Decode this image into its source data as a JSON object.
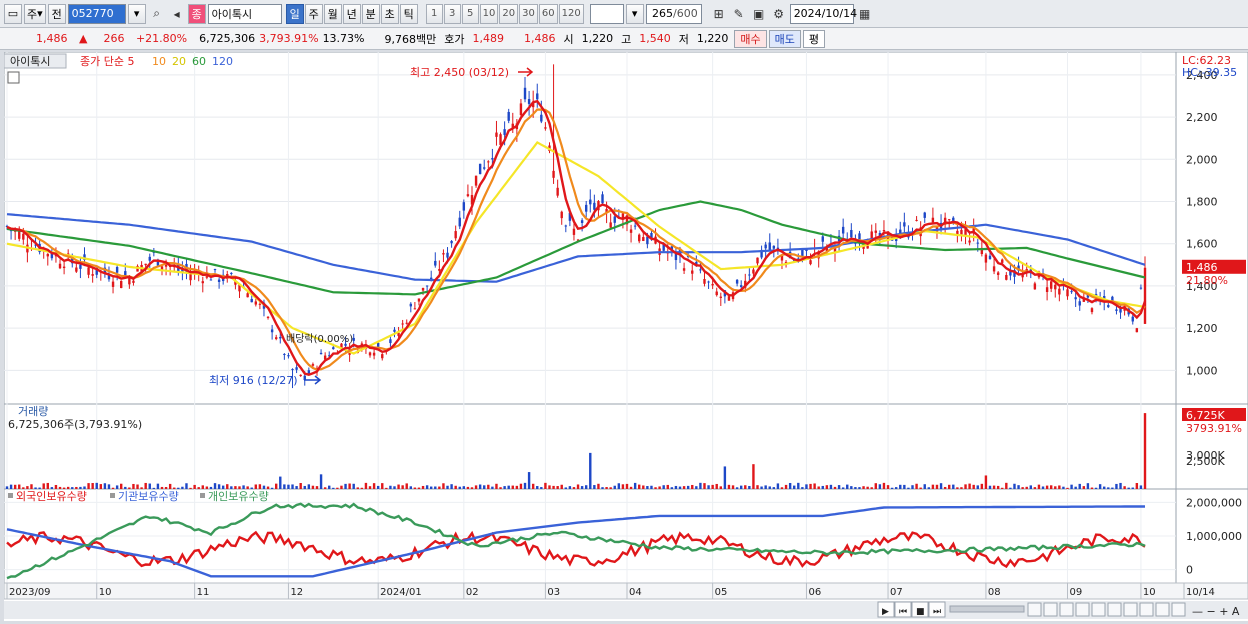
{
  "toolbar": {
    "period_label": "주",
    "prev_label": "전",
    "code": "052770",
    "stock_name": "아이톡시",
    "stock_tag": "종",
    "tabs": [
      "일",
      "주",
      "월",
      "년",
      "분",
      "초",
      "틱"
    ],
    "active_tab": "일",
    "minutes": [
      "1",
      "3",
      "5",
      "10",
      "20",
      "30",
      "60",
      "120"
    ],
    "count": "265",
    "count_total": "/600",
    "date": "2024/10/14"
  },
  "info": {
    "price": "1,486",
    "change_arrow": "▲",
    "change": "266",
    "change_pct": "+21.80%",
    "volume": "6,725,306",
    "volume_pct": "3,793.91%",
    "turnover_pct": "13.73%",
    "trade_value": "9,768백만",
    "quote_label": "호가",
    "ask": "1,489",
    "bid": "1,486",
    "open_label": "시",
    "open": "1,220",
    "high_label": "고",
    "high": "1,540",
    "low_label": "저",
    "low": "1,220",
    "buy_label": "매수",
    "sell_label": "매도",
    "eval_label": "평"
  },
  "colors": {
    "up": "#e0171a",
    "down": "#1d47c7",
    "ma5": "#e0171a",
    "ma10": "#f08a1c",
    "ma20": "#f5e628",
    "ma60": "#2a9a3a",
    "ma120": "#3a62d8",
    "foreign": "#e0171a",
    "institution": "#3a62d8",
    "individual": "#3a9a5a"
  },
  "chart_data": [
    {
      "type": "candlestick",
      "title": "아이톡시",
      "legend": {
        "prefix": "종가 단순",
        "periods": [
          "5",
          "10",
          "20",
          "60",
          "120"
        ]
      },
      "lc": "LC:62.23",
      "hc": "HC:-39.35",
      "current_price_label": "1,486",
      "current_change_label": "21.80%",
      "ylim": [
        850,
        2480
      ],
      "yticks": [
        "1,000",
        "1,200",
        "1,400",
        "1,600",
        "1,800",
        "2,000",
        "2,200",
        "2,400"
      ],
      "max_annotation": "최고 2,450 (03/12)",
      "min_annotation": "최저 916 (12/27)",
      "dividend_annotation": "배당락(0.00%)",
      "close_anchors": [
        [
          0,
          1680
        ],
        [
          12,
          1540
        ],
        [
          22,
          1470
        ],
        [
          30,
          1440
        ],
        [
          36,
          1540
        ],
        [
          42,
          1470
        ],
        [
          50,
          1450
        ],
        [
          57,
          1420
        ],
        [
          62,
          1300
        ],
        [
          66,
          1170
        ],
        [
          70,
          1000
        ],
        [
          73,
          960
        ],
        [
          77,
          1060
        ],
        [
          82,
          1120
        ],
        [
          87,
          1120
        ],
        [
          92,
          1100
        ],
        [
          96,
          1180
        ],
        [
          100,
          1320
        ],
        [
          104,
          1430
        ],
        [
          108,
          1560
        ],
        [
          112,
          1780
        ],
        [
          116,
          1950
        ],
        [
          120,
          2080
        ],
        [
          124,
          2150
        ],
        [
          128,
          2280
        ],
        [
          131,
          2230
        ],
        [
          133,
          2080
        ],
        [
          135,
          1880
        ],
        [
          137,
          1700
        ],
        [
          140,
          1640
        ],
        [
          143,
          1780
        ],
        [
          147,
          1740
        ],
        [
          152,
          1720
        ],
        [
          157,
          1620
        ],
        [
          162,
          1560
        ],
        [
          168,
          1500
        ],
        [
          173,
          1380
        ],
        [
          177,
          1320
        ],
        [
          182,
          1470
        ],
        [
          186,
          1580
        ],
        [
          190,
          1540
        ],
        [
          194,
          1520
        ],
        [
          198,
          1560
        ],
        [
          202,
          1600
        ],
        [
          208,
          1640
        ],
        [
          214,
          1620
        ],
        [
          218,
          1640
        ],
        [
          223,
          1680
        ],
        [
          228,
          1700
        ],
        [
          233,
          1660
        ],
        [
          237,
          1640
        ],
        [
          241,
          1520
        ],
        [
          245,
          1480
        ],
        [
          249,
          1450
        ],
        [
          253,
          1440
        ],
        [
          257,
          1400
        ],
        [
          262,
          1340
        ],
        [
          266,
          1320
        ],
        [
          270,
          1320
        ],
        [
          274,
          1300
        ],
        [
          277,
          1230
        ],
        [
          279,
          1486
        ]
      ],
      "ma_anchors": {
        "ma120": [
          [
            0,
            1740
          ],
          [
            30,
            1690
          ],
          [
            60,
            1610
          ],
          [
            80,
            1500
          ],
          [
            100,
            1430
          ],
          [
            120,
            1420
          ],
          [
            140,
            1540
          ],
          [
            160,
            1560
          ],
          [
            180,
            1560
          ],
          [
            200,
            1580
          ],
          [
            220,
            1650
          ],
          [
            240,
            1690
          ],
          [
            260,
            1620
          ],
          [
            279,
            1500
          ]
        ],
        "ma60": [
          [
            0,
            1670
          ],
          [
            30,
            1590
          ],
          [
            60,
            1460
          ],
          [
            80,
            1370
          ],
          [
            100,
            1360
          ],
          [
            120,
            1440
          ],
          [
            140,
            1610
          ],
          [
            160,
            1760
          ],
          [
            170,
            1800
          ],
          [
            180,
            1760
          ],
          [
            190,
            1690
          ],
          [
            210,
            1600
          ],
          [
            230,
            1570
          ],
          [
            250,
            1580
          ],
          [
            260,
            1530
          ],
          [
            279,
            1440
          ]
        ],
        "ma20": [
          [
            0,
            1600
          ],
          [
            30,
            1490
          ],
          [
            55,
            1440
          ],
          [
            70,
            1200
          ],
          [
            85,
            1080
          ],
          [
            100,
            1220
          ],
          [
            115,
            1700
          ],
          [
            130,
            2080
          ],
          [
            145,
            1920
          ],
          [
            160,
            1680
          ],
          [
            175,
            1480
          ],
          [
            190,
            1500
          ],
          [
            210,
            1590
          ],
          [
            225,
            1660
          ],
          [
            238,
            1630
          ],
          [
            255,
            1440
          ],
          [
            270,
            1330
          ],
          [
            279,
            1300
          ]
        ]
      },
      "months": [
        "2023/09",
        "10",
        "11",
        "12",
        "2024/01",
        "02",
        "03",
        "04",
        "05",
        "06",
        "07",
        "08",
        "09",
        "10",
        "10/14"
      ]
    },
    {
      "type": "bar",
      "title": "거래량",
      "summary": "6,725,306주(3,793.91%)",
      "yticks": [
        "2,500K",
        "3,000K"
      ],
      "ylim": [
        0,
        7000000
      ],
      "last_label": "6,725K",
      "last_pct_label": "3793.91%",
      "spikes": [
        [
          67,
          1100000
        ],
        [
          77,
          1300000
        ],
        [
          128,
          1500000
        ],
        [
          143,
          3200000
        ],
        [
          176,
          2000000
        ],
        [
          183,
          2200000
        ],
        [
          240,
          1200000
        ],
        [
          279,
          6725306
        ]
      ]
    },
    {
      "type": "line",
      "legend": [
        "외국인보유수량",
        "기관보유수량",
        "개인보유수량"
      ],
      "yticks": [
        "0",
        "1,000,000",
        "2,000,000"
      ],
      "ylim": [
        -400000,
        2400000
      ]
    }
  ]
}
